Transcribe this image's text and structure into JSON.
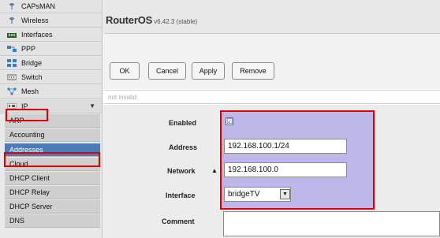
{
  "sidebar": {
    "items": [
      {
        "label": "CAPsMAN",
        "icon": "antenna-icon"
      },
      {
        "label": "Wireless",
        "icon": "antenna-icon"
      },
      {
        "label": "Interfaces",
        "icon": "interfaces-icon"
      },
      {
        "label": "PPP",
        "icon": "ppp-icon"
      },
      {
        "label": "Bridge",
        "icon": "bridge-icon"
      },
      {
        "label": "Switch",
        "icon": "switch-icon"
      },
      {
        "label": "Mesh",
        "icon": "mesh-icon"
      },
      {
        "label": "IP",
        "icon": "ip-icon"
      }
    ],
    "ip_submenu": [
      "ARP",
      "Accounting",
      "Addresses",
      "Cloud",
      "DHCP Client",
      "DHCP Relay",
      "DHCP Server",
      "DNS"
    ],
    "active_submenu": "Addresses",
    "ip_chevron": "▼"
  },
  "header": {
    "product": "RouterOS",
    "version": "v6.42.3 (stable)"
  },
  "toolbar": {
    "ok": "OK",
    "cancel": "Cancel",
    "apply": "Apply",
    "remove": "Remove"
  },
  "status": {
    "text": "not invalid"
  },
  "form": {
    "enabled_label": "Enabled",
    "enabled_checked": "☑",
    "address_label": "Address",
    "address_value": "192.168.100.1/24",
    "network_label": "Network",
    "network_toggle": "▲",
    "network_value": "192.168.100.0",
    "interface_label": "Interface",
    "interface_value": "bridgeTV",
    "interface_arrow": "▼",
    "comment_label": "Comment",
    "comment_value": ""
  }
}
